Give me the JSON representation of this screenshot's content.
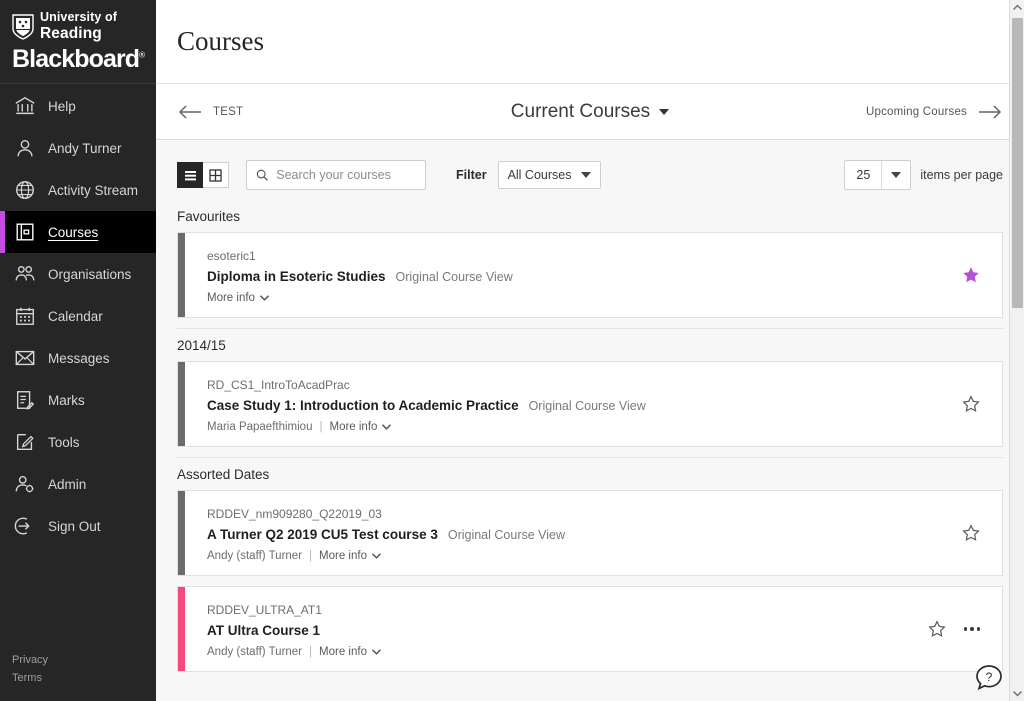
{
  "sidebar": {
    "brand": {
      "university_line1": "University of",
      "university_line2": "Reading",
      "product": "Blackboard",
      "trademark": "®"
    },
    "items": [
      {
        "label": "Help",
        "icon": "bank-icon",
        "active": false
      },
      {
        "label": "Andy Turner",
        "icon": "person-icon",
        "active": false
      },
      {
        "label": "Activity Stream",
        "icon": "globe-icon",
        "active": false
      },
      {
        "label": "Courses",
        "icon": "book-icon",
        "active": true
      },
      {
        "label": "Organisations",
        "icon": "people-icon",
        "active": false
      },
      {
        "label": "Calendar",
        "icon": "calendar-icon",
        "active": false
      },
      {
        "label": "Messages",
        "icon": "envelope-icon",
        "active": false
      },
      {
        "label": "Marks",
        "icon": "marks-icon",
        "active": false
      },
      {
        "label": "Tools",
        "icon": "tools-icon",
        "active": false
      },
      {
        "label": "Admin",
        "icon": "admin-icon",
        "active": false
      },
      {
        "label": "Sign Out",
        "icon": "sign-out-icon",
        "active": false
      }
    ],
    "footer": {
      "privacy": "Privacy",
      "terms": "Terms"
    },
    "accent_color": "#c44ce0"
  },
  "header": {
    "title": "Courses"
  },
  "term_nav": {
    "previous_label": "TEST",
    "current_label": "Current Courses",
    "next_label": "Upcoming Courses"
  },
  "toolbar": {
    "list_view_label": "list-view",
    "grid_view_label": "grid-view",
    "search_placeholder": "Search your courses",
    "search_value": "",
    "filter_label": "Filter",
    "filter_value": "All Courses",
    "per_page_value": "25",
    "per_page_text": "items per page"
  },
  "groups": [
    {
      "heading": "Favourites",
      "courses": [
        {
          "id": "esoteric1",
          "title": "Diploma in Esoteric Studies",
          "view_tag": "Original Course View",
          "instructor": "",
          "more_info": "More info",
          "favourite": true,
          "accent": "standard",
          "has_overflow": false
        }
      ]
    },
    {
      "heading": "2014/15",
      "courses": [
        {
          "id": "RD_CS1_IntroToAcadPrac",
          "title": "Case Study 1: Introduction to Academic Practice",
          "view_tag": "Original Course View",
          "instructor": "Maria Papaefthimiou",
          "more_info": "More info",
          "favourite": false,
          "accent": "standard",
          "has_overflow": false
        }
      ]
    },
    {
      "heading": "Assorted Dates",
      "courses": [
        {
          "id": "RDDEV_nm909280_Q22019_03",
          "title": "A Turner Q2 2019 CU5 Test course 3",
          "view_tag": "Original Course View",
          "instructor": "Andy (staff) Turner",
          "more_info": "More info",
          "favourite": false,
          "accent": "standard",
          "has_overflow": false
        },
        {
          "id": "RDDEV_ULTRA_AT1",
          "title": "AT Ultra Course 1",
          "view_tag": "",
          "instructor": "Andy (staff) Turner",
          "more_info": "More info",
          "favourite": false,
          "accent": "ultra",
          "has_overflow": true
        }
      ]
    }
  ],
  "help_widget": {
    "label": "?"
  },
  "colors": {
    "favourite_star": "#b54fd8",
    "ultra_accent": "#f5497f",
    "standard_accent": "#6b6b6b",
    "sidebar_bg": "#262626"
  }
}
